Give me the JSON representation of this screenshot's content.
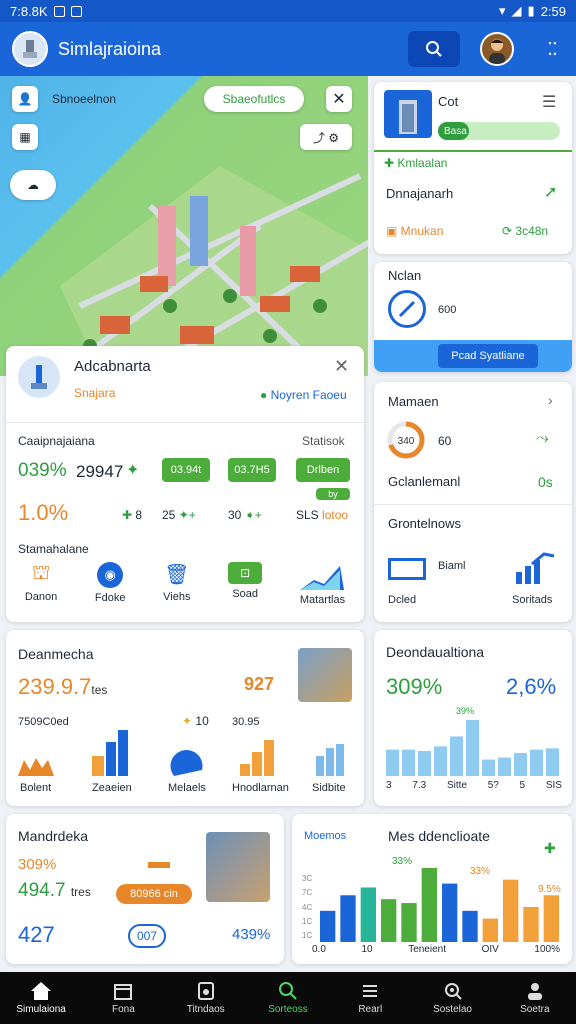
{
  "status": {
    "time": "7:8.8K",
    "battery": "2:59"
  },
  "appbar": {
    "title": "Simlajraioina"
  },
  "map": {
    "location_label": "Sbnoeelnon",
    "location_chip": "Sbaeofutlcs"
  },
  "detail_card": {
    "title": "Adcabnarta",
    "subtitle": "Snajara",
    "status": "Noyren Faoeu",
    "section_left": "Caaipnajaiana",
    "section_right": "Statisok",
    "stat_pct": "039%",
    "stat_num": "29947",
    "pill1": "03.94t",
    "pill2": "03.7H5",
    "pill3": "Drlben",
    "small_badge": "by",
    "stat2": "1.0%",
    "mini1": "8",
    "mini2": "25",
    "mini3": "30",
    "mini4": "SLS",
    "mini4b": "lotoo",
    "actions_title": "Stamahalane",
    "actions": [
      {
        "label": "Danon",
        "color": "#e8862a"
      },
      {
        "label": "Fdoke",
        "color": "#1a66d9"
      },
      {
        "label": "Viehs",
        "color": "#1a66d9"
      },
      {
        "label": "Soad",
        "color": "#4cad3a"
      },
      {
        "label": "Matartlas",
        "color": "#1a66d9"
      }
    ]
  },
  "right_top": {
    "title": "Cot",
    "progress_label": "Basa",
    "progress": 0.25,
    "row1": "Kmlaalan",
    "row2": "Dnnajanarh",
    "row3_left": "Mnukan",
    "row3_right": "3c48n"
  },
  "right_mid": {
    "title": "Nclan",
    "value": "600",
    "button": "Pcad Syatliane"
  },
  "right_stats": {
    "title": "Mamaen",
    "ring_value": "340",
    "ring_progress": 0.7,
    "ring_label": "60",
    "row2_left": "Gclanlemanl",
    "row2_right": "0s",
    "row3": "Grontelnows",
    "bottom_left_label": "Biaml",
    "bottom_left_caption": "Dcled",
    "bottom_right_caption": "Soritads"
  },
  "analytics_left": {
    "title": "Deanmecha",
    "big_value": "239.9.7",
    "big_unit": "tes",
    "badge": "927",
    "small_label": "7509C0ed",
    "small_num": "10",
    "small_num2": "30.95",
    "icons": [
      {
        "label": "Bolent"
      },
      {
        "label": "Zeaeien"
      },
      {
        "label": "Melaels"
      },
      {
        "label": "Hnodlarnan"
      },
      {
        "label": "Sidbite"
      }
    ]
  },
  "analytics_right": {
    "title": "Deondaualtiona",
    "val_green": "309%",
    "val_blue": "2,6%",
    "top_label": "39%",
    "x_labels": [
      "3",
      "7.3",
      "Sitte",
      "5?",
      "5",
      "SIS"
    ],
    "chart_data": {
      "type": "bar",
      "values": [
        40,
        40,
        38,
        45,
        60,
        85,
        25,
        28,
        35,
        40,
        42
      ]
    }
  },
  "bottom_left": {
    "title": "Mandrdeka",
    "row1": "309%",
    "row2_value": "494.7",
    "row2_unit": "tres",
    "badge": "80966 cin",
    "row3_left": "427",
    "row3_mid": "007",
    "row3_right": "439%"
  },
  "bottom_right": {
    "legend": "Moemos",
    "title": "Mes ddenclioate",
    "label_a": "33%",
    "label_b": "33%",
    "label_c": "9.5%",
    "x_labels": [
      "0.0",
      "10",
      "Teneient",
      "OIV",
      "100%"
    ],
    "y_labels": [
      "3C",
      "7C",
      "4C",
      "1C",
      "1C"
    ],
    "chart_data": {
      "type": "bar",
      "values": [
        40,
        60,
        70,
        55,
        50,
        95,
        75,
        40,
        30,
        80,
        45,
        60
      ],
      "colors": [
        "#1a66d9",
        "#1a66d9",
        "#27b59a",
        "#4cad3a",
        "#4cad3a",
        "#4cad3a",
        "#1a66d9",
        "#1a66d9",
        "#f2a03a",
        "#f2a03a",
        "#f2a03a",
        "#f2a03a"
      ]
    }
  },
  "nav": [
    {
      "label": "Simulaiona",
      "icon": "home-icon"
    },
    {
      "label": "Fona",
      "icon": "calendar-icon"
    },
    {
      "label": "Titndaos",
      "icon": "device-icon"
    },
    {
      "label": "Sorteoss",
      "icon": "search-icon"
    },
    {
      "label": "Rearl",
      "icon": "list-icon"
    },
    {
      "label": "Sostelao",
      "icon": "zoom-icon"
    },
    {
      "label": "Soetra",
      "icon": "people-icon"
    }
  ]
}
